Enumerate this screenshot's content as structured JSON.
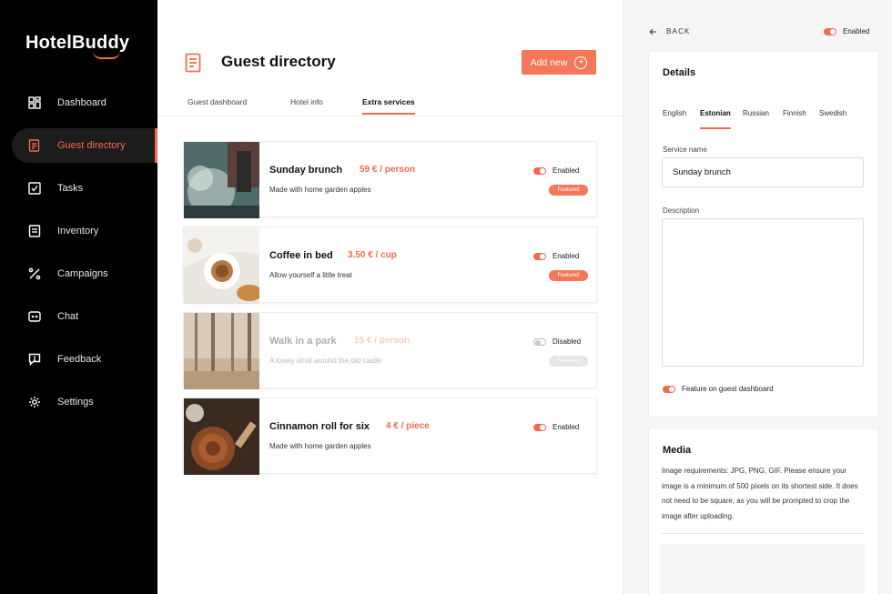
{
  "app": {
    "logo_text": "HotelBuddy"
  },
  "sidebar": {
    "items": [
      {
        "label": "Dashboard",
        "icon": "dashboard-icon"
      },
      {
        "label": "Guest directory",
        "icon": "document-icon",
        "active": true
      },
      {
        "label": "Tasks",
        "icon": "checkbox-icon"
      },
      {
        "label": "Inventory",
        "icon": "list-icon"
      },
      {
        "label": "Campaigns",
        "icon": "percent-icon"
      },
      {
        "label": "Chat",
        "icon": "chat-icon"
      },
      {
        "label": "Feedback",
        "icon": "feedback-icon"
      },
      {
        "label": "Settings",
        "icon": "gear-icon"
      }
    ]
  },
  "main": {
    "title": "Guest directory",
    "add_button": "Add new",
    "tabs": [
      {
        "label": "Guest dashboard"
      },
      {
        "label": "Hotel info"
      },
      {
        "label": "Extra services",
        "active": true
      }
    ],
    "services": [
      {
        "name": "Sunday brunch",
        "price": "59 € / person",
        "description": "Made with home garden apples",
        "status": "Enabled",
        "badge": "Featured",
        "enabled": true
      },
      {
        "name": "Coffee in bed",
        "price": "3.50 € / cup",
        "description": "Allow yourself a little treat",
        "status": "Enabled",
        "badge": "Featured",
        "enabled": true
      },
      {
        "name": "Walk in a park",
        "price": "15 € / person",
        "description": "A lovely stroll around the old castle",
        "status": "Disabled",
        "badge": "Featured",
        "enabled": false
      },
      {
        "name": "Cinnamon roll for six",
        "price": "4 € / piece",
        "description": "Made with home garden apples",
        "status": "Enabled",
        "badge": "",
        "enabled": true
      }
    ]
  },
  "panel": {
    "back_label": "BACK",
    "status": "Enabled",
    "details": {
      "title": "Details",
      "languages": [
        "English",
        "Estonian",
        "Russian",
        "Finnish",
        "Swedish"
      ],
      "active_language": "Estonian",
      "service_name_label": "Service name",
      "service_name_value": "Sunday brunch",
      "description_label": "Description",
      "description_value": "",
      "feature_label": "Feature on guest dashboard"
    },
    "media": {
      "title": "Media",
      "requirements": "Image requirements: JPG, PNG, GIF. Please ensure your image is a minimum of 500 pixels on its shortest side. It does not need to be square, as you will be prompted to crop the image after uploading."
    }
  },
  "colors": {
    "accent": "#f26b4f",
    "sidebar_bg": "#000000",
    "panel_bg": "#f6f6f6"
  }
}
